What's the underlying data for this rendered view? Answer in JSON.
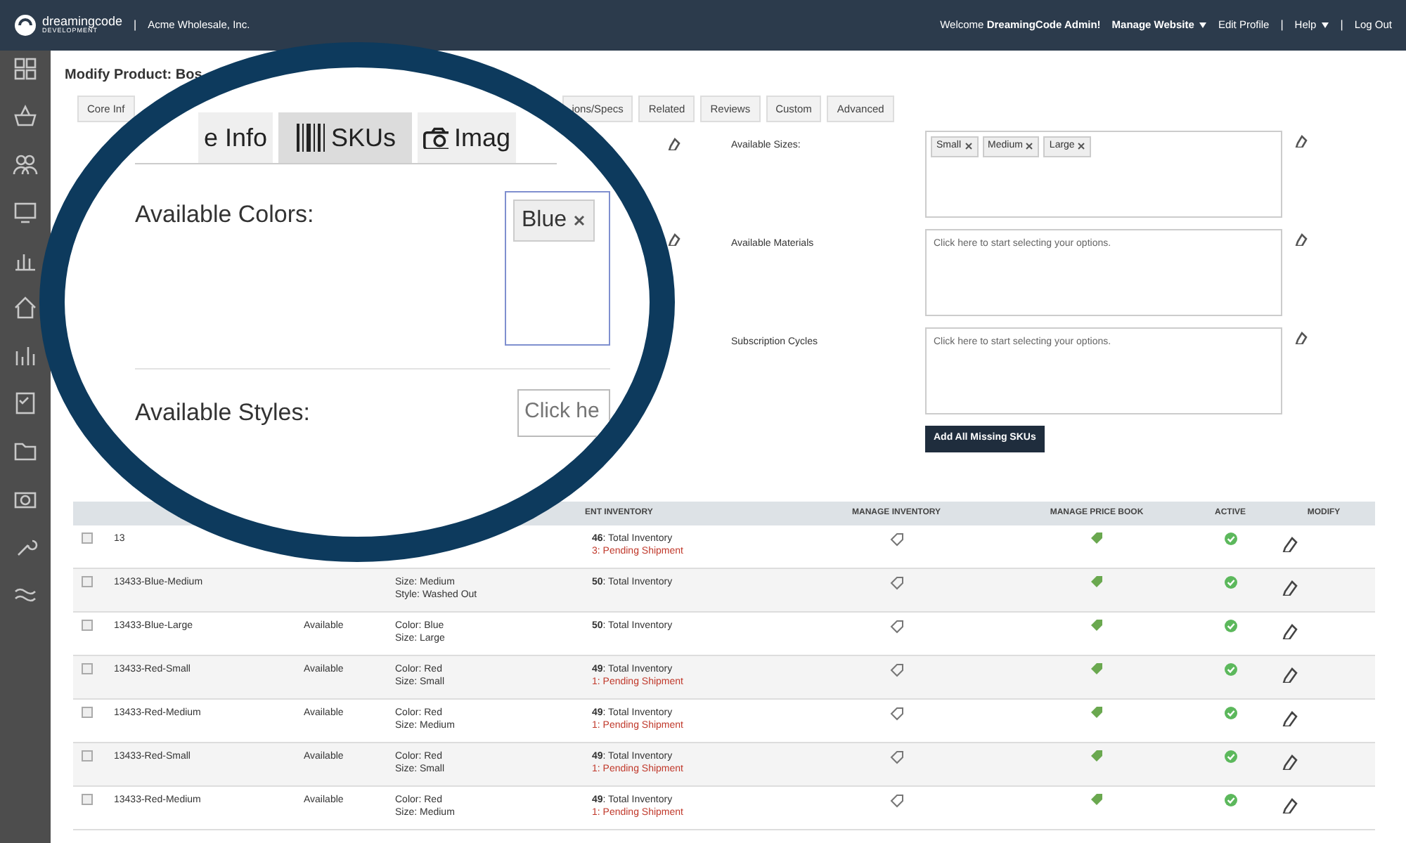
{
  "top_bar": {
    "logo": "dreamingcode",
    "logo_sub": "DEVELOPMENT",
    "divider": "|",
    "company": "Acme Wholesale, Inc.",
    "welcome": "Welcome **DreamingCode Admin!**",
    "links": [
      {
        "label": "Manage Website",
        "dropdown": true,
        "bold": true
      },
      {
        "label": "Edit Profile",
        "dropdown": false,
        "bold": false
      },
      {
        "label": "Help",
        "dropdown": true,
        "bold": false,
        "separator": "|"
      },
      {
        "label": "Log Out",
        "dropdown": false,
        "bold": false,
        "separator": "|"
      }
    ]
  },
  "page_title": "Modify Product: Bos",
  "tabs": [
    {
      "label": "Core Inf",
      "selected": false
    },
    {
      "label": "ions/Specs",
      "selected": false
    },
    {
      "label": "Related",
      "selected": false
    },
    {
      "label": "Reviews",
      "selected": false
    },
    {
      "label": "Custom",
      "selected": false
    },
    {
      "label": "Advanced",
      "selected": false
    }
  ],
  "form_fields": [
    {
      "label": "Available Sizes:",
      "chips": [
        "Small",
        "Medium",
        "Large"
      ]
    },
    {
      "label": "Available Materials",
      "placeholder": "Click here to start selecting your options."
    },
    {
      "label": "Subscription Cycles",
      "placeholder": "Click here to start selecting your options."
    }
  ],
  "add_button": "Add All Missing SKUs",
  "magnifier": {
    "tabs": [
      {
        "label": "e Info",
        "kind": "text",
        "selected": false
      },
      {
        "label": "SKUs",
        "kind": "barcode",
        "selected": true
      },
      {
        "label": "Imag",
        "kind": "camera",
        "selected": false
      }
    ],
    "fields": [
      {
        "label": "Available Colors:",
        "chips": [
          "Blue"
        ]
      },
      {
        "label": "Available Styles:",
        "placeholder": "Click he"
      }
    ]
  },
  "table": {
    "columns": [
      "ENT INVENTORY",
      "MANAGE INVENTORY",
      "MANAGE PRICE BOOK",
      "ACTIVE",
      "MODIFY"
    ],
    "rows": [
      {
        "checked": false,
        "sku": "13",
        "inventory": "**46**: Total Inventory",
        "pending": "3: Pending Shipment",
        "active": true
      },
      {
        "checked": false,
        "sku": "13433-Blue-Medium",
        "options": [
          "Size: Medium",
          "Style: Washed Out"
        ],
        "inventory": "**50**: Total Inventory",
        "active": true
      },
      {
        "checked": false,
        "sku": "13433-Blue-Large",
        "status": "Available",
        "options": [
          "Color: Blue",
          "Size: Large"
        ],
        "inventory": "**50**: Total Inventory",
        "active": true
      },
      {
        "checked": false,
        "sku": "13433-Red-Small",
        "status": "Available",
        "options": [
          "Color: Red",
          "Size: Small"
        ],
        "inventory": "**49**: Total Inventory",
        "pending": "1: Pending Shipment",
        "active": true
      },
      {
        "checked": false,
        "sku": "13433-Red-Medium",
        "status": "Available",
        "options": [
          "Color: Red",
          "Size: Medium"
        ],
        "inventory": "**49**: Total Inventory",
        "pending": "1: Pending Shipment",
        "active": true
      },
      {
        "checked": false,
        "sku": "13433-Red-Small",
        "status": "Available",
        "options": [
          "Color: Red",
          "Size: Small"
        ],
        "inventory": "**49**: Total Inventory",
        "pending": "1: Pending Shipment",
        "active": true
      },
      {
        "checked": false,
        "sku": "13433-Red-Medium",
        "status": "Available",
        "options": [
          "Color: Red",
          "Size: Medium"
        ],
        "inventory": "**49**: Total Inventory",
        "pending": "1: Pending Shipment",
        "active": true
      }
    ]
  }
}
